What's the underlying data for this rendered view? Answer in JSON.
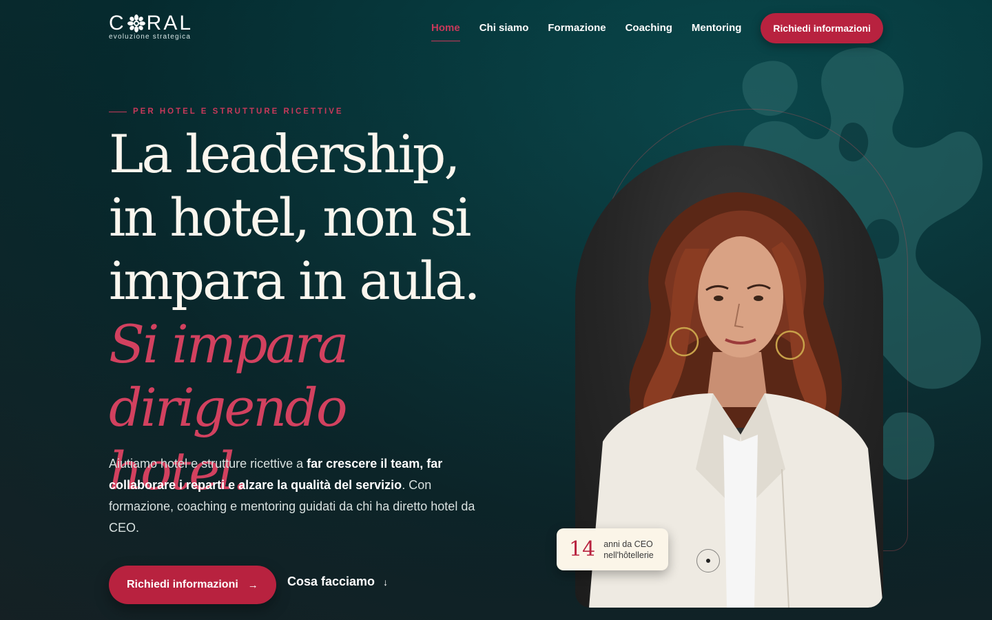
{
  "brand": {
    "name": "CORAL",
    "tagline": "evoluzione strategica",
    "accent": "#b8223f",
    "bg": "#06373b"
  },
  "nav": {
    "items": [
      {
        "label": "Home",
        "active": true
      },
      {
        "label": "Chi siamo",
        "active": false
      },
      {
        "label": "Formazione",
        "active": false
      },
      {
        "label": "Coaching",
        "active": false
      },
      {
        "label": "Mentoring",
        "active": false
      }
    ],
    "cta": "Richiedi informazioni"
  },
  "hero": {
    "eyebrow": "PER HOTEL E STRUTTURE RICETTIVE",
    "headline_1": "La leadership, in hotel, non si impara in aula.",
    "headline_2": "Si impara dirigendo hotel.",
    "lead_1": "Aiutiamo hotel e strutture ricettive a ",
    "lead_bold": "far crescere il team, far collaborare i reparti e alzare la qualità del servizio",
    "lead_2": ". Con formazione, coaching e mentoring guidati da chi ha diretto hotel da CEO.",
    "primary_cta": "Richiedi informazioni",
    "primary_icon": "arrow-right-icon",
    "secondary_cta": "Cosa facciamo",
    "secondary_icon": "arrow-down-icon"
  },
  "badge": {
    "number": "14",
    "line_1": "anni da CEO",
    "line_2": "nell'hôtellerie"
  }
}
